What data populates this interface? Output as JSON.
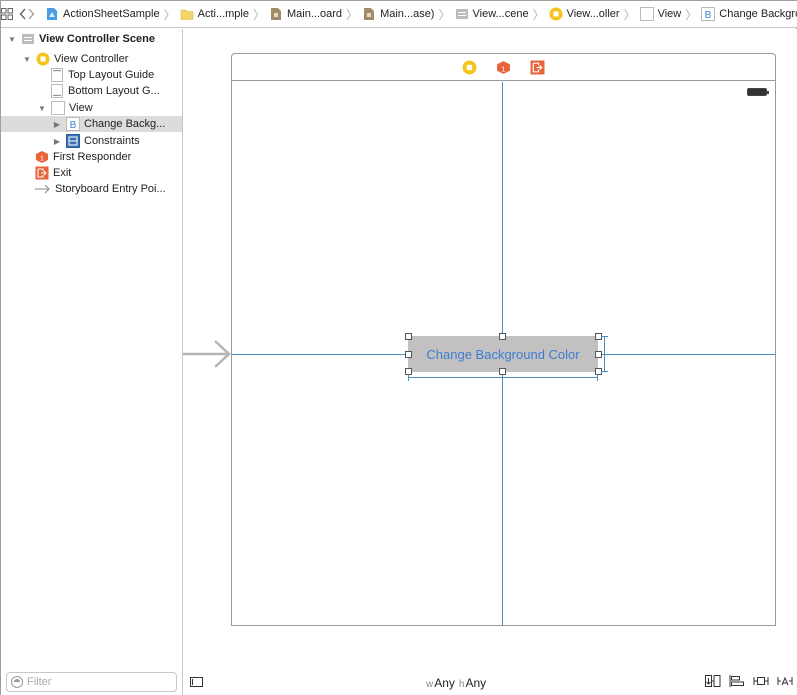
{
  "jumpbar": {
    "nav": {
      "grid_icon": "related-items-icon",
      "back_icon": "chevron-left-icon",
      "forward_icon": "chevron-right-icon"
    },
    "crumbs": [
      {
        "label": "ActionSheetSample",
        "icon": "project-icon"
      },
      {
        "label": "Acti...mple",
        "icon": "folder-icon"
      },
      {
        "label": "Main...oard",
        "icon": "storyboard-icon"
      },
      {
        "label": "Main...ase)",
        "icon": "storyboard-icon"
      },
      {
        "label": "View...cene",
        "icon": "scene-icon"
      },
      {
        "label": "View...oller",
        "icon": "view-controller-icon"
      },
      {
        "label": "View",
        "icon": "view-icon"
      },
      {
        "label": "Change Background Color",
        "icon": "button-icon"
      }
    ]
  },
  "outline": {
    "items": [
      {
        "label": "View Controller Scene",
        "icon": "scene-icon",
        "expanded": true,
        "level": 0,
        "bold": true
      },
      {
        "label": "View Controller",
        "icon": "view-controller-icon",
        "expanded": true,
        "level": 1
      },
      {
        "label": "Top Layout Guide",
        "icon": "layout-guide-top-icon",
        "level": 2
      },
      {
        "label": "Bottom Layout G...",
        "icon": "layout-guide-bottom-icon",
        "level": 2
      },
      {
        "label": "View",
        "icon": "view-icon",
        "expanded": true,
        "level": 2
      },
      {
        "label": "Change Backg...",
        "icon": "button-icon",
        "expanded": false,
        "level": 3,
        "selected": true
      },
      {
        "label": "Constraints",
        "icon": "constraints-icon",
        "expanded": false,
        "level": 3
      },
      {
        "label": "First Responder",
        "icon": "first-responder-icon",
        "level": 1
      },
      {
        "label": "Exit",
        "icon": "exit-icon",
        "level": 1
      },
      {
        "label": "Storyboard Entry Poi...",
        "icon": "entry-point-arrow-icon",
        "level": 1
      }
    ],
    "filter_placeholder": "Filter",
    "filter_value": ""
  },
  "canvas": {
    "button_title": "Change Background Color",
    "dock_icons": [
      "view-controller-icon",
      "first-responder-icon",
      "exit-icon"
    ],
    "colors": {
      "guide": "#4a8fc2",
      "button_bg": "#c2c0c0",
      "button_text": "#3d7dd0"
    }
  },
  "bottombar": {
    "w_prefix": "w",
    "w_value": "Any",
    "h_prefix": "h",
    "h_value": "Any",
    "tools": [
      "stack-icon",
      "align-icon",
      "pin-icon",
      "resolve-issues-icon"
    ]
  },
  "colors": {
    "accent_yellow": "#f5c31b",
    "accent_orange": "#e8623a",
    "accent_blue": "#3c7fd1"
  }
}
